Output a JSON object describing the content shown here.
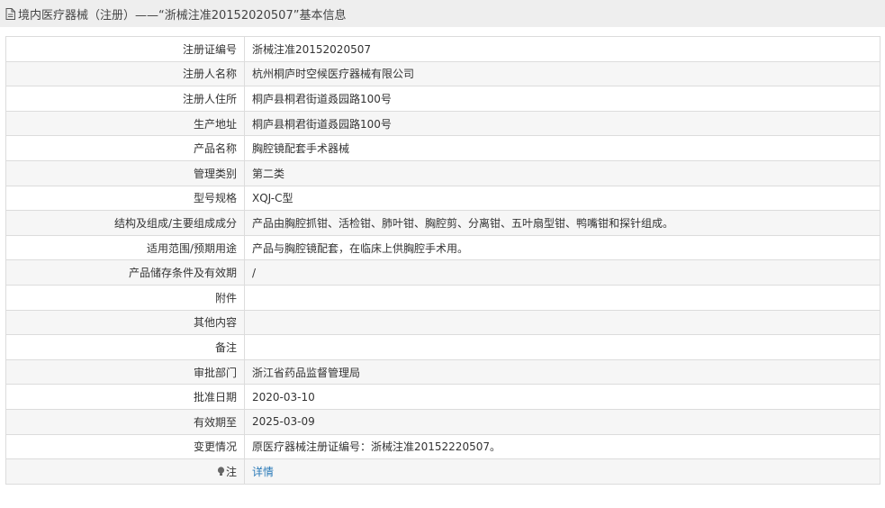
{
  "header": {
    "icon": "document-icon",
    "title": "境内医疗器械（注册）——“浙械注准20152020507”基本信息"
  },
  "rows": [
    {
      "label": "注册证编号",
      "value": "浙械注准20152020507"
    },
    {
      "label": "注册人名称",
      "value": "杭州桐庐时空候医疗器械有限公司"
    },
    {
      "label": "注册人住所",
      "value": "桐庐县桐君街道叒园路100号"
    },
    {
      "label": "生产地址",
      "value": "桐庐县桐君街道叒园路100号"
    },
    {
      "label": "产品名称",
      "value": "胸腔镜配套手术器械"
    },
    {
      "label": "管理类别",
      "value": "第二类"
    },
    {
      "label": "型号规格",
      "value": "XQJ-C型"
    },
    {
      "label": "结构及组成/主要组成成分",
      "value": "产品由胸腔抓钳、活检钳、肺叶钳、胸腔剪、分离钳、五叶扇型钳、鸭嘴钳和探针组成。"
    },
    {
      "label": "适用范围/预期用途",
      "value": "产品与胸腔镜配套，在临床上供胸腔手术用。"
    },
    {
      "label": "产品储存条件及有效期",
      "value": "/"
    },
    {
      "label": "附件",
      "value": ""
    },
    {
      "label": "其他内容",
      "value": ""
    },
    {
      "label": "备注",
      "value": ""
    },
    {
      "label": "审批部门",
      "value": "浙江省药品监督管理局"
    },
    {
      "label": "批准日期",
      "value": "2020-03-10"
    },
    {
      "label": "有效期至",
      "value": "2025-03-09"
    },
    {
      "label": "变更情况",
      "value": "原医疗器械注册证编号：浙械注准20152220507。"
    }
  ],
  "note_row": {
    "icon": "lightbulb-icon",
    "label": "注",
    "link": "详情"
  },
  "colors": {
    "link": "#2a7ab8",
    "header_bg": "#eeeeee",
    "border": "#dcdcdc"
  }
}
